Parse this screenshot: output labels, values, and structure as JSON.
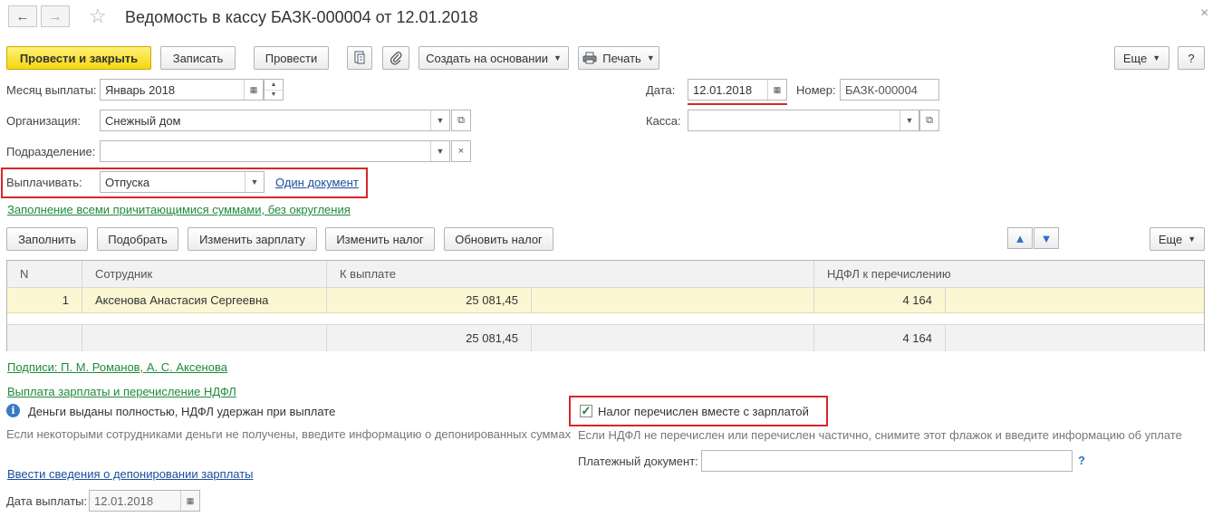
{
  "window": {
    "title": "Ведомость в кассу БАЗК-000004 от 12.01.2018",
    "back_icon": "←",
    "forward_icon": "→",
    "star_icon": "☆",
    "close_icon": "×"
  },
  "toolbar": {
    "post_and_close": "Провести и закрыть",
    "save": "Записать",
    "post": "Провести",
    "create_based_on": "Создать на основании",
    "print": "Печать",
    "more": "Еще",
    "help": "?"
  },
  "form": {
    "pay_month_label": "Месяц выплаты:",
    "pay_month_value": "Январь 2018",
    "date_label": "Дата:",
    "date_value": "12.01.2018",
    "number_label": "Номер:",
    "number_value": "БАЗК-000004",
    "organization_label": "Организация:",
    "organization_value": "Снежный дом",
    "cashbox_label": "Касса:",
    "cashbox_value": "",
    "department_label": "Подразделение:",
    "department_value": "",
    "pay_label": "Выплачивать:",
    "pay_value": "Отпуска",
    "one_document_link": "Один документ",
    "fill_mode_link": "Заполнение всеми причитающимися суммами, без округления"
  },
  "table_toolbar": {
    "fill": "Заполнить",
    "select": "Подобрать",
    "change_salary": "Изменить зарплату",
    "change_tax": "Изменить налог",
    "update_tax": "Обновить налог",
    "more": "Еще"
  },
  "table": {
    "columns": [
      "N",
      "Сотрудник",
      "К выплате",
      "НДФЛ к перечислению"
    ],
    "rows": [
      {
        "n": "1",
        "employee": "Аксенова Анастасия Сергеевна",
        "to_pay": "25 081,45",
        "ndfl": "4 164"
      }
    ],
    "totals": {
      "to_pay": "25 081,45",
      "ndfl": "4 164"
    }
  },
  "bottom": {
    "signatures_link": "Подписи: П. М. Романов, А. С. Аксенова",
    "salary_payment_link": "Выплата зарплаты и перечисление НДФЛ",
    "money_paid_text": "Деньги выданы полностью, НДФЛ удержан при выплате",
    "money_paid_hint": "Если некоторыми сотрудниками деньги не получены, введите информацию о депонированных суммах",
    "tax_transferred_label": "Налог перечислен вместе с зарплатой",
    "tax_transferred_checked": true,
    "tax_hint": "Если НДФЛ не перечислен или перечислен частично, снимите этот флажок и введите информацию об уплате",
    "payment_doc_label": "Платежный документ:",
    "payment_doc_value": "",
    "payment_doc_help": "?",
    "deposit_link": "Ввести сведения о депонировании зарплаты",
    "pay_date_label": "Дата выплаты:",
    "pay_date_value": "12.01.2018"
  },
  "colors": {
    "primary_button": "#f5d70f",
    "highlight_red": "#d7272b",
    "link_green": "#1f8a3a",
    "link_blue": "#1a4e9a",
    "selected_row": "#fbf7d2"
  }
}
